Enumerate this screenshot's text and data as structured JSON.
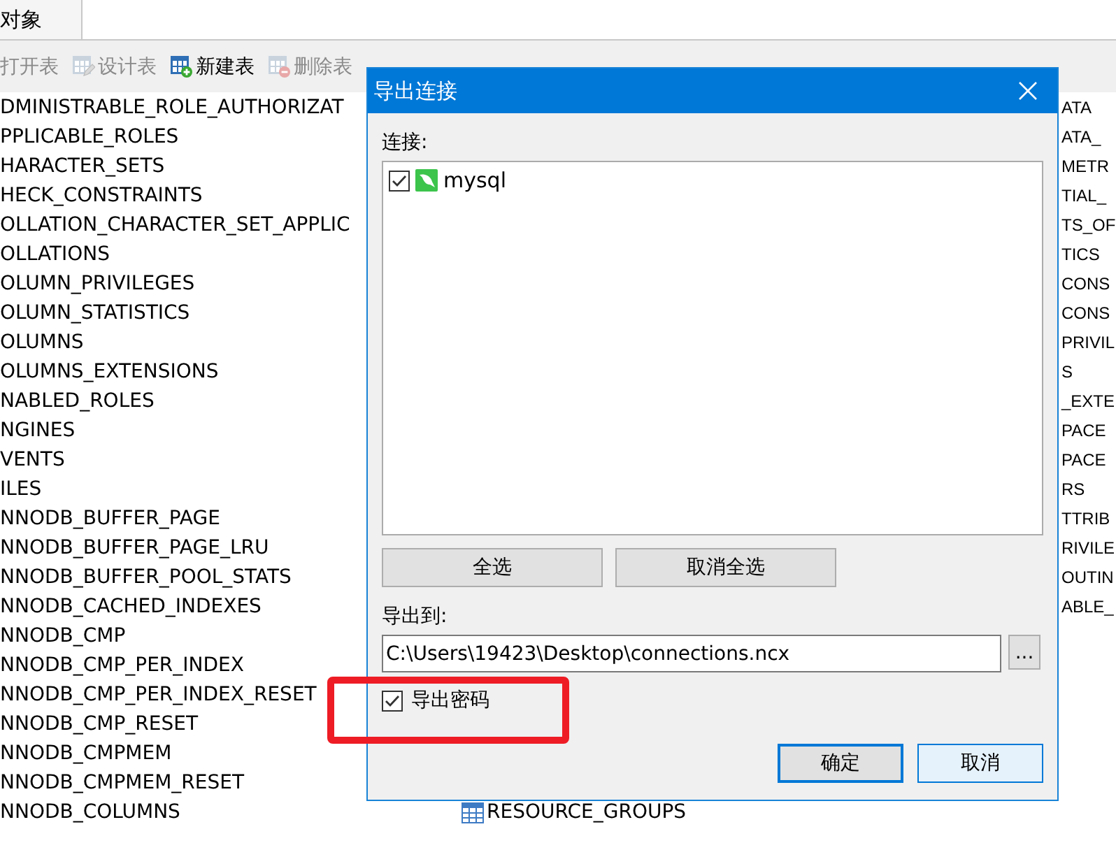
{
  "tab": {
    "label": "对象"
  },
  "toolbar": [
    {
      "label": "打开表",
      "disabled": true
    },
    {
      "label": "设计表",
      "disabled": true,
      "kind": "edit"
    },
    {
      "label": "新建表",
      "disabled": false,
      "kind": "add"
    },
    {
      "label": "删除表",
      "disabled": true,
      "kind": "remove"
    }
  ],
  "tables_left": [
    "DMINISTRABLE_ROLE_AUTHORIZAT",
    "PPLICABLE_ROLES",
    "HARACTER_SETS",
    "HECK_CONSTRAINTS",
    "OLLATION_CHARACTER_SET_APPLIC",
    "OLLATIONS",
    "OLUMN_PRIVILEGES",
    "OLUMN_STATISTICS",
    "OLUMNS",
    "OLUMNS_EXTENSIONS",
    "NABLED_ROLES",
    "NGINES",
    "VENTS",
    "ILES",
    "NNODB_BUFFER_PAGE",
    "NNODB_BUFFER_PAGE_LRU",
    "NNODB_BUFFER_POOL_STATS",
    "NNODB_CACHED_INDEXES",
    "NNODB_CMP",
    "NNODB_CMP_PER_INDEX",
    "NNODB_CMP_PER_INDEX_RESET",
    "NNODB_CMP_RESET",
    "NNODB_CMPMEM",
    "NNODB_CMPMEM_RESET",
    "NNODB_COLUMNS"
  ],
  "tables_middle": [
    "RESOURCE_GROUPS"
  ],
  "tables_right": [
    "ATA",
    "ATA_",
    "METR",
    "TIAL_",
    "TS_OF",
    "TICS",
    "CONS",
    "CONS",
    "PRIVIL",
    "S",
    "_EXTE",
    "PACE",
    "PACE",
    "RS",
    "TTRIB",
    "RIVILE",
    "OUTIN",
    "ABLE_"
  ],
  "dialog": {
    "title": "导出连接",
    "connections_label": "连接:",
    "connections": [
      {
        "name": "mysql",
        "checked": true
      }
    ],
    "select_buttons": [
      "全选",
      "取消全选"
    ],
    "export_to_label": "导出到:",
    "path": "C:\\Users\\19423\\Desktop\\connections.ncx",
    "browse": "...",
    "export_password": {
      "label": "导出密码",
      "checked": true
    },
    "actions": [
      {
        "label": "确定",
        "default": true,
        "hovered": false
      },
      {
        "label": "取消",
        "default": false,
        "hovered": true
      }
    ]
  }
}
